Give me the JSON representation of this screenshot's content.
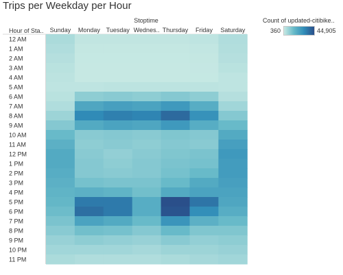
{
  "chart_data": {
    "type": "heatmap",
    "title": "Trips per Weekday per Hour",
    "column_header": "Stoptime",
    "row_header": "Hour of Sta..",
    "columns": [
      "Sunday",
      "Monday",
      "Tuesday",
      "Wednes..",
      "Thursday",
      "Friday",
      "Saturday"
    ],
    "rows": [
      "12 AM",
      "1 AM",
      "2 AM",
      "3 AM",
      "4 AM",
      "5 AM",
      "6 AM",
      "7 AM",
      "8 AM",
      "9 AM",
      "10 AM",
      "11 AM",
      "12 PM",
      "1 PM",
      "2 PM",
      "3 PM",
      "4 PM",
      "5 PM",
      "6 PM",
      "7 PM",
      "8 PM",
      "9 PM",
      "10 PM",
      "11 PM"
    ],
    "values": [
      [
        6000,
        1500,
        1500,
        1500,
        1500,
        2000,
        5000
      ],
      [
        5000,
        800,
        800,
        800,
        800,
        1200,
        4500
      ],
      [
        4000,
        500,
        500,
        500,
        500,
        800,
        4000
      ],
      [
        3000,
        400,
        400,
        400,
        400,
        600,
        3000
      ],
      [
        2500,
        400,
        400,
        400,
        400,
        500,
        2000
      ],
      [
        2000,
        2000,
        2500,
        2500,
        2500,
        2500,
        2000
      ],
      [
        3000,
        12000,
        13000,
        12000,
        14000,
        12000,
        4000
      ],
      [
        5000,
        26000,
        28000,
        27000,
        30000,
        24000,
        8000
      ],
      [
        9000,
        34000,
        36000,
        35000,
        40000,
        32000,
        14000
      ],
      [
        14000,
        25000,
        27000,
        26000,
        30000,
        24000,
        20000
      ],
      [
        20000,
        13000,
        14000,
        13000,
        15000,
        14000,
        25000
      ],
      [
        23000,
        12000,
        13000,
        12000,
        14000,
        13000,
        28000
      ],
      [
        25000,
        13000,
        11000,
        13000,
        15000,
        16000,
        30000
      ],
      [
        25000,
        14000,
        12000,
        14000,
        16000,
        17000,
        29000
      ],
      [
        24000,
        14000,
        13000,
        14000,
        17000,
        20000,
        29000
      ],
      [
        23000,
        17000,
        16000,
        16000,
        20000,
        25000,
        28000
      ],
      [
        22000,
        23000,
        22000,
        18000,
        25000,
        27000,
        27000
      ],
      [
        21000,
        37000,
        37000,
        24000,
        44905,
        38000,
        26000
      ],
      [
        19000,
        39000,
        37000,
        24000,
        44000,
        33000,
        24000
      ],
      [
        16000,
        27000,
        25000,
        20000,
        31000,
        23000,
        20000
      ],
      [
        13000,
        18000,
        17000,
        14000,
        20000,
        15000,
        15000
      ],
      [
        10000,
        12000,
        11000,
        10000,
        13000,
        11000,
        12000
      ],
      [
        8000,
        8000,
        8000,
        7000,
        9000,
        9000,
        10000
      ],
      [
        6000,
        5000,
        5000,
        5000,
        6000,
        7000,
        8000
      ]
    ],
    "legend": {
      "title": "Count of updated-citibike..",
      "min_label": "360",
      "max_label": "44,905",
      "min": 360,
      "max": 44905,
      "color_low": "#c6e8e3",
      "color_high": "#2a4f8a"
    }
  }
}
